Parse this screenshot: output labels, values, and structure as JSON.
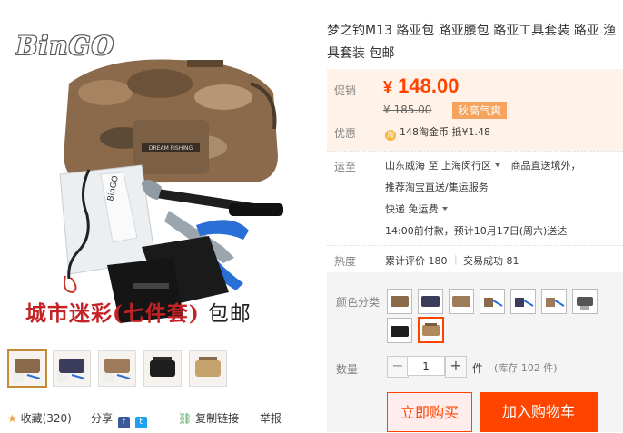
{
  "product": {
    "title": "梦之钓M13 路亚包 路亚腰包 路亚工具套装 路亚 渔具套装 包邮",
    "brand_logo": "BinGO",
    "image_caption": "城市迷彩(七件套)",
    "image_caption_extra": "包邮",
    "bag_label": "DREAM FISHING",
    "case_label": "BinGO"
  },
  "thumbnails": [
    "thumb-1",
    "thumb-2",
    "thumb-3",
    "thumb-4",
    "thumb-5"
  ],
  "price": {
    "promo_label": "促销",
    "currency": "¥",
    "value": "148.00",
    "original": "¥ 185.00",
    "badge": "秋高气爽",
    "discount_label": "优惠",
    "coin_text": "148淘金币 抵¥1.48"
  },
  "shipping": {
    "label": "运至",
    "from": "山东威海 至",
    "to": "上海闵行区",
    "note": "商品直送境外，",
    "note2": "推荐淘宝直送/集运服务",
    "method": "快递 免运费",
    "eta": "14:00前付款，预计10月17日(周六)送达"
  },
  "stats": {
    "label": "热度",
    "reviews": "累计评价 180",
    "sales": "交易成功 81"
  },
  "options": {
    "color_label": "颜色分类",
    "swatch_count": 9,
    "selected_index": 8,
    "qty_label": "数量",
    "qty_value": "1",
    "qty_unit": "件",
    "stock": "(库存 102 件)",
    "minus": "−",
    "plus": "+"
  },
  "buttons": {
    "buy_now": "立即购买",
    "add_cart": "加入购物车"
  },
  "bottom": {
    "favorite": "收藏(320)",
    "share": "分享",
    "copy_link": "复制链接",
    "report": "举报"
  },
  "colors": {
    "accent": "#ff4400",
    "price_bg": "#fff2e8",
    "badge": "#f6a35d"
  }
}
